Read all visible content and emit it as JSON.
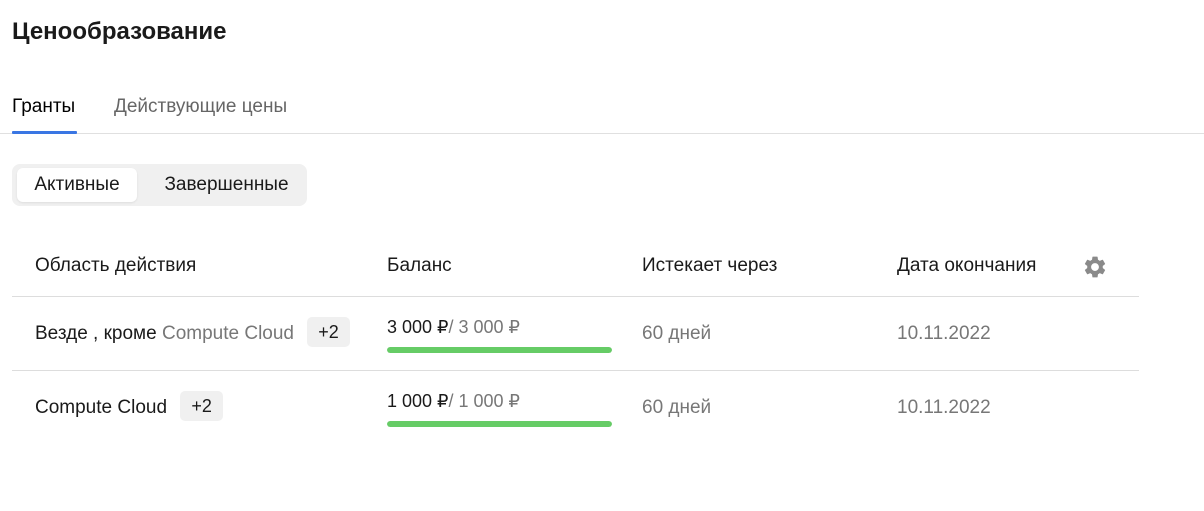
{
  "page": {
    "title": "Ценообразование"
  },
  "tabs": [
    {
      "label": "Гранты",
      "active": true
    },
    {
      "label": "Действующие цены",
      "active": false
    }
  ],
  "filter": {
    "options": [
      {
        "label": "Активные",
        "selected": true
      },
      {
        "label": "Завершенные",
        "selected": false
      }
    ]
  },
  "table": {
    "columns": {
      "scope": "Область действия",
      "balance": "Баланс",
      "expires_in": "Истекает через",
      "end_date": "Дата окончания"
    },
    "settings_icon": "gear-icon",
    "rows": [
      {
        "scope_text": "Везде , кроме",
        "scope_service": "Compute Cloud",
        "extra_count": "+2",
        "balance_current": "3 000 ₽",
        "balance_total": "/ 3 000 ₽",
        "balance_fraction": 1.0,
        "expires_in": "60 дней",
        "end_date": "10.11.2022"
      },
      {
        "scope_text": "Compute Cloud",
        "scope_service": "",
        "extra_count": "+2",
        "balance_current": "1 000 ₽",
        "balance_total": "/ 1 000 ₽",
        "balance_fraction": 1.0,
        "expires_in": "60 дней",
        "end_date": "10.11.2022"
      }
    ]
  },
  "colors": {
    "accent": "#3a76e3",
    "progress": "#66cc66"
  }
}
